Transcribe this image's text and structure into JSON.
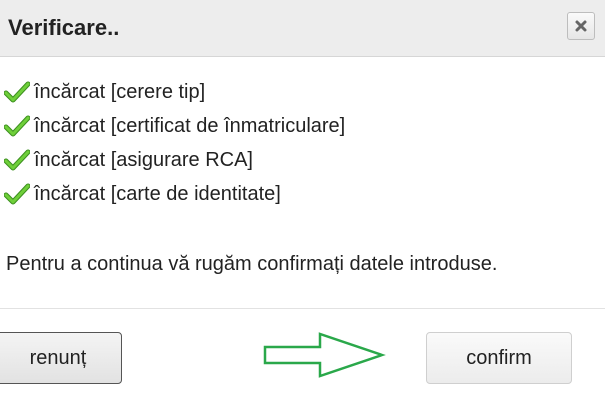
{
  "dialog": {
    "title": "Verificare..",
    "close_icon": "close-icon"
  },
  "checks": [
    {
      "icon": "checkmark-icon",
      "label": "încărcat [cerere tip]"
    },
    {
      "icon": "checkmark-icon",
      "label": "încărcat [certificat de înmatriculare]"
    },
    {
      "icon": "checkmark-icon",
      "label": "încărcat [asigurare RCA]"
    },
    {
      "icon": "checkmark-icon",
      "label": "încărcat [carte de identitate]"
    }
  ],
  "message": "Pentru a continua vă rugăm confirmați datele introduse.",
  "buttons": {
    "cancel_label": "renunț",
    "confirm_label": "confirm"
  },
  "arrow_icon": "right-arrow-icon",
  "colors": {
    "check_green": "#5cb82e",
    "arrow_green": "#2aa84a",
    "titlebar_bg": "#ededed"
  }
}
